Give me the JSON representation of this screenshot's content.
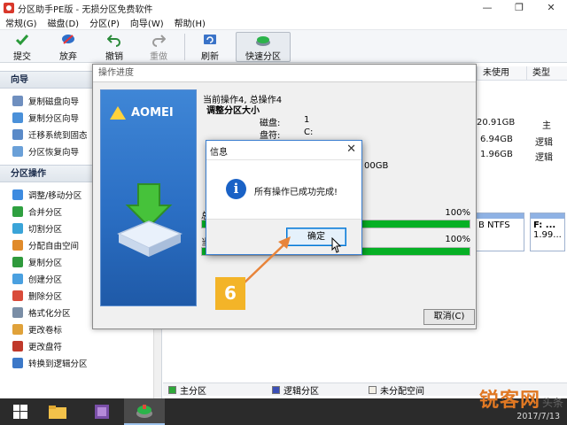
{
  "window": {
    "title": "分区助手PE版 - 无损分区免费软件",
    "controls": [
      "—",
      "❐",
      "✕"
    ]
  },
  "menu": [
    "常规(G)",
    "磁盘(D)",
    "分区(P)",
    "向导(W)",
    "帮助(H)"
  ],
  "toolbar": {
    "submit": "提交",
    "discard": "放弃",
    "undo": "撤销",
    "redo": "重做",
    "refresh": "刷新",
    "quick_partition": "快速分区"
  },
  "left": {
    "wizard_head": "向导",
    "wizard_items": [
      "复制磁盘向导",
      "复制分区向导",
      "迁移系统到固态",
      "分区恢复向导"
    ],
    "ops_head": "分区操作",
    "ops_items": [
      "调整/移动分区",
      "合并分区",
      "切割分区",
      "分配自由空间",
      "复制分区",
      "创建分区",
      "删除分区",
      "格式化分区",
      "更改卷标",
      "更改盘符",
      "转换到逻辑分区"
    ]
  },
  "main": {
    "col_unused": "未使用",
    "col_type": "类型",
    "rows": [
      {
        "unused": "20.91GB",
        "type": "主"
      },
      {
        "unused": "6.94GB",
        "type": "逻辑"
      },
      {
        "unused": "1.96GB",
        "type": "逻辑"
      }
    ],
    "disk_boxes": [
      {
        "t1": "",
        "t2": "B NTFS"
      },
      {
        "t1": "F: ...",
        "t2": "1.99..."
      }
    ]
  },
  "legend": {
    "primary": "主分区",
    "logical": "逻辑分区",
    "unallocated": "未分配空间",
    "primary_color": "#2fa83a",
    "logical_color": "#3b4fb5",
    "unallocated_color": "#f2efe6"
  },
  "progress_dialog": {
    "title": "操作进度",
    "logo": "AOMEI",
    "current_op": "当前操作4, 总操作4",
    "op_name": "调整分区大小",
    "fields": [
      {
        "key": "磁盘:",
        "val": "1"
      },
      {
        "key": "盘符:",
        "val": "C:"
      }
    ],
    "partial_size": "00GB",
    "bar1_label": "总",
    "bar1_percent": "100%",
    "bar1_value": 1.0,
    "bar2_label": "当",
    "bar2_percent": "100%",
    "bar2_value": 1.0,
    "cancel": "取消(C)"
  },
  "msgbox": {
    "title": "信息",
    "close": "✕",
    "message": "所有操作已成功完成!",
    "ok": "确定"
  },
  "annotation": {
    "step": "6"
  },
  "watermark": {
    "brand": "锐客网",
    "tag": "头条"
  },
  "taskbar": {
    "date": "2017/7/13"
  }
}
